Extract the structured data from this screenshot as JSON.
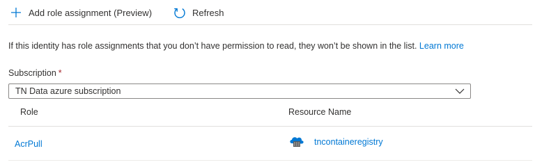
{
  "toolbar": {
    "add_label": "Add role assignment (Preview)",
    "add_icon": "plus-icon",
    "refresh_label": "Refresh",
    "refresh_icon": "refresh-icon"
  },
  "info": {
    "text": "If this identity has role assignments that you don’t have permission to read, they won’t be shown in the list.",
    "link_text": "Learn more"
  },
  "subscription": {
    "label": "Subscription",
    "required_marker": "*",
    "selected": "TN Data azure subscription"
  },
  "table": {
    "headers": {
      "role": "Role",
      "resource": "Resource Name"
    },
    "rows": [
      {
        "role": "AcrPull",
        "resource": "tncontaineregistry",
        "resource_icon": "container-registry-icon"
      }
    ]
  },
  "colors": {
    "link": "#0078d4",
    "accent": "#0078d4",
    "required": "#a4262c",
    "text": "#323130",
    "divider": "#e1dfdd"
  }
}
